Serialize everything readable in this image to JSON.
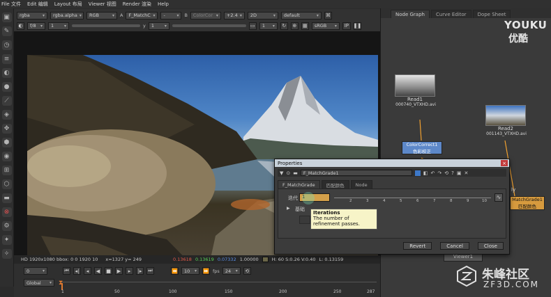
{
  "menu": [
    "File 文件",
    "Edit 编辑",
    "Layout 布局",
    "Viewer 视图",
    "Render 渲染",
    "Help"
  ],
  "viewer_controls": {
    "row1": {
      "channels": "rgba",
      "alpha": "rgba.alpha",
      "colorspace": "RGB",
      "a_label": "A",
      "a_input": "F_MatchC",
      "b_dash": "-",
      "b_label": "B",
      "b_input": "ColorCor",
      "gain": "+2.4",
      "view_mode": "2D",
      "lut": "default"
    },
    "row2": {
      "fstop": "f/8",
      "frame": "1",
      "y_label": "y",
      "y_value": "1",
      "proxy": "1",
      "display": "sRGB",
      "ip": "IP"
    }
  },
  "info_bar": {
    "format": "HD 1920x1080 bbox: 0 0 1920 10",
    "coords": "x=1327 y= 249",
    "r": "0.13618",
    "g": "0.13619",
    "b": "0.07332",
    "a": "1.00000",
    "hsv": "H: 60 S:0.26 V:0.40",
    "l": "L: 0.13159",
    "colors": {
      "r": "#e35a4a",
      "g": "#58d058",
      "b": "#5a8ee6"
    }
  },
  "timeline": {
    "frame": "0",
    "end": "10",
    "fps_label": "fps",
    "fps": "24",
    "global": "Global",
    "ticks": [
      "1",
      "50",
      "100",
      "150",
      "200",
      "250",
      "287"
    ],
    "playhead": "1"
  },
  "node_graph": {
    "tabs": [
      "Node Graph",
      "Curve Editor",
      "Dope Sheet"
    ],
    "nodes": {
      "read1": {
        "name": "Read1",
        "file": "000740_VTXHD.avi"
      },
      "read2": {
        "name": "Read2",
        "file": "001143_VTXHD.avi"
      },
      "cc": {
        "name": "ColorCorrect1",
        "sub": "色彩校正"
      },
      "mg": {
        "name": "MatchGrade1",
        "sub": "匹配颜色"
      },
      "viewer_node": "Viewer1",
      "ly_label": "ly"
    }
  },
  "properties": {
    "title": "Properties",
    "node_name": "F_MatchGrade1",
    "tabs": [
      "F_MatchGrade",
      "匹配颜色",
      "Node"
    ],
    "iterations_label": "迭代",
    "iterations_value": "1",
    "ruler_ticks": [
      "1",
      "2",
      "3",
      "4",
      "5",
      "6",
      "7",
      "8",
      "9",
      "10"
    ],
    "row_label": "基础",
    "tooltip_title": "Iterations",
    "tooltip_text": "The number of refinement passes.",
    "revert": "Revert",
    "cancel": "Cancel",
    "close": "Close"
  },
  "watermarks": {
    "youku_en": "YOUKU",
    "youku_cn": "优酷",
    "zf3d_cn": "朱峰社区",
    "zf3d_url": "ZF3D.COM"
  }
}
